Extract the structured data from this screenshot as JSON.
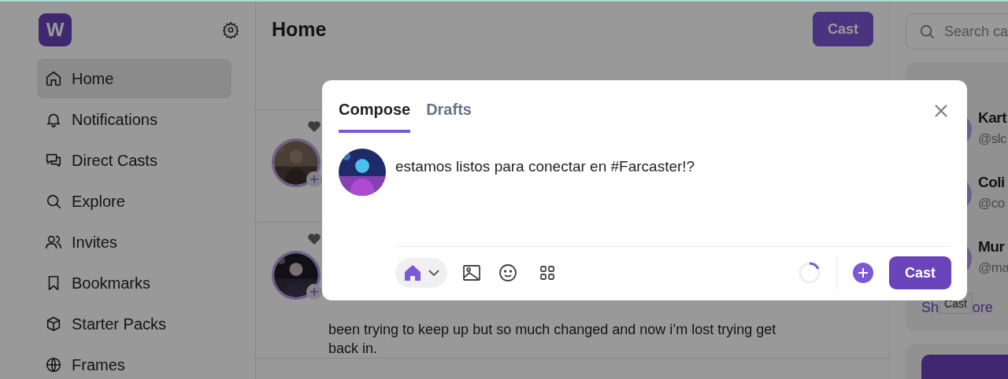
{
  "sidebar": {
    "logo": "W",
    "items": [
      {
        "label": "Home",
        "selected": true
      },
      {
        "label": "Notifications",
        "selected": false
      },
      {
        "label": "Direct Casts",
        "selected": false
      },
      {
        "label": "Explore",
        "selected": false
      },
      {
        "label": "Invites",
        "selected": false
      },
      {
        "label": "Bookmarks",
        "selected": false
      },
      {
        "label": "Starter Packs",
        "selected": false
      },
      {
        "label": "Frames",
        "selected": false
      }
    ]
  },
  "main": {
    "title": "Home",
    "cast_button": "Cast",
    "posts": [
      {
        "kind": "picture"
      },
      {
        "kind": "picture",
        "text": "been trying to keep up but so much changed and now i’m lost trying get back in."
      }
    ]
  },
  "right": {
    "search": {
      "placeholder": "Search ca"
    },
    "suggested": [
      {
        "name": "Kart",
        "handle": "@slc"
      },
      {
        "name": "Coli",
        "handle": "@co"
      },
      {
        "name": "Mur",
        "handle": "@ma"
      }
    ],
    "show_more": [
      "Sh",
      "ore"
    ]
  },
  "modal": {
    "tabs": [
      {
        "label": "Compose",
        "selected": true
      },
      {
        "label": "Drafts",
        "selected": false
      }
    ],
    "text": "estamos listos para conectar en #Farcaster!?",
    "cast_button": "Cast",
    "tooltip": "Cast"
  }
}
